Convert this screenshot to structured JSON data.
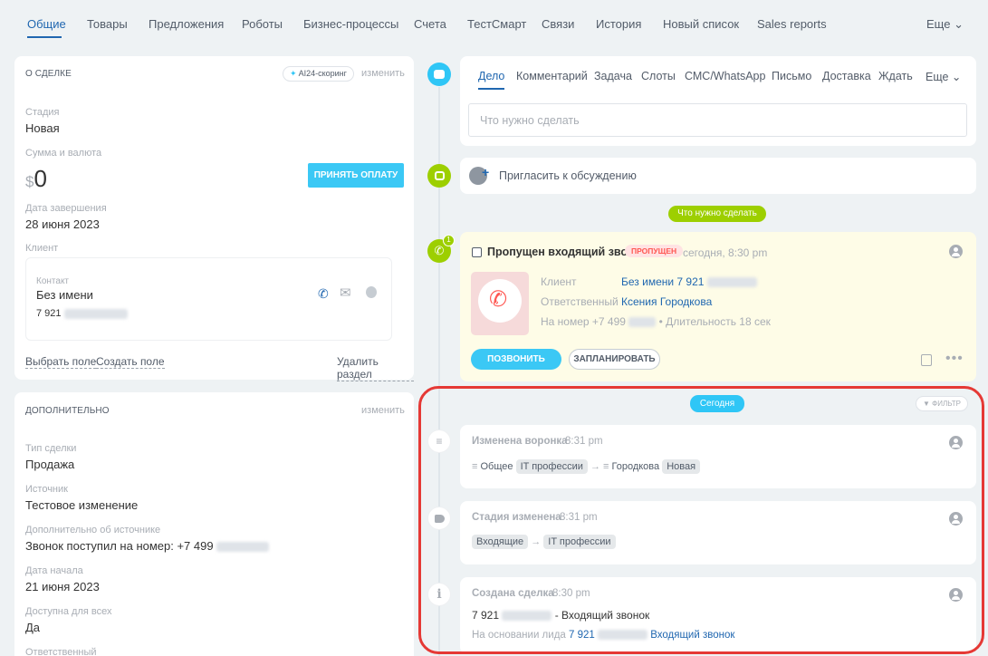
{
  "tabs": [
    "Общие",
    "Товары",
    "Предложения",
    "Роботы",
    "Бизнес-процессы",
    "Счета",
    "ТестСмарт",
    "Связи",
    "История",
    "Новый список",
    "Sales reports"
  ],
  "tabs_more": "Еще",
  "about": {
    "title": "О СДЕЛКЕ",
    "ai_badge": "AI24-скоринг",
    "edit": "изменить",
    "stage_label": "Стадия",
    "stage_value": "Новая",
    "sum_label": "Сумма и валюта",
    "currency": "$",
    "sum_value": "0",
    "pay_button": "ПРИНЯТЬ ОПЛАТУ",
    "end_label": "Дата завершения",
    "end_value": "28 июня 2023",
    "client_label": "Клиент",
    "contact_label": "Контакт",
    "contact_name": "Без имени",
    "contact_phone": "7 921",
    "select_field": "Выбрать поле",
    "create_field": "Создать поле",
    "delete_section": "Удалить раздел"
  },
  "extra": {
    "title": "ДОПОЛНИТЕЛЬНО",
    "edit": "изменить",
    "type_label": "Тип сделки",
    "type_value": "Продажа",
    "source_label": "Источник",
    "source_value": "Тестовое изменение",
    "source_info_label": "Дополнительно об источнике",
    "source_info_value": "Звонок поступил на номер: +7 499",
    "start_label": "Дата начала",
    "start_value": "21 июня 2023",
    "access_label": "Доступна для всех",
    "access_value": "Да",
    "responsible_label": "Ответственный"
  },
  "activity_tabs": [
    "Дело",
    "Комментарий",
    "Задача",
    "Слоты",
    "СМС/WhatsApp",
    "Письмо",
    "Доставка",
    "Ждать"
  ],
  "activity_more": "Еще",
  "todo_placeholder": "Что нужно сделать",
  "invite_text": "Пригласить к обсуждению",
  "todo_divider": "Что нужно сделать",
  "missed_call": {
    "title": "Пропущен входящий звонок",
    "badge": "ПРОПУЩЕН",
    "time": "сегодня, 8:30 pm",
    "counter": "1",
    "client_label": "Клиент",
    "client_value": "Без имени 7 921",
    "responsible_label": "Ответственный",
    "responsible_value": "Ксения Городкова",
    "number_text": "На номер +7 499",
    "duration_text": "• Длительность 18 сек",
    "call_button": "ПОЗВОНИТЬ",
    "plan_button": "ЗАПЛАНИРОВАТЬ"
  },
  "today_divider": "Сегодня",
  "filter_label": "ФИЛЬТР",
  "events": [
    {
      "title": "Изменена воронка",
      "time": "8:31 pm",
      "from_funnel": "Общее",
      "from_stage": "IT профессии",
      "to_funnel": "Городкова",
      "to_stage": "Новая"
    },
    {
      "title": "Стадия изменена",
      "time": "8:31 pm",
      "from_stage": "Входящие",
      "to_stage": "IT профессии"
    },
    {
      "title": "Создана сделка",
      "time": "8:30 pm",
      "line1_prefix": "7 921",
      "line1_suffix": "- Входящий звонок",
      "line2_prefix": "На основании лида",
      "line2_phone": "7 921",
      "line2_link": "Входящий звонок"
    }
  ],
  "colors": {
    "accent": "#2067b0",
    "button": "#3bc8f5",
    "green": "#9dcf00",
    "highlight": "#e53935",
    "missed_bg": "#fefce7"
  }
}
